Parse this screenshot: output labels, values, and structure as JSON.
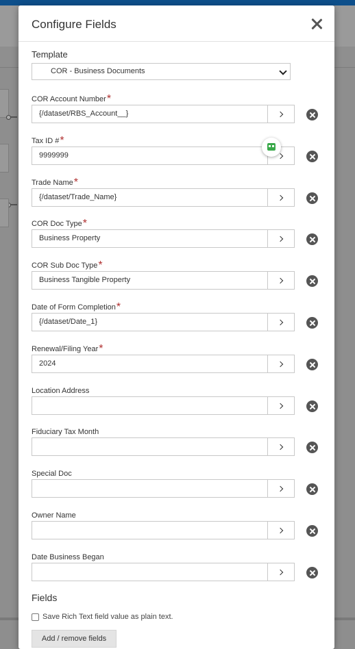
{
  "dialog": {
    "title": "Configure Fields",
    "template_label": "Template",
    "template_value": "COR - Business Documents"
  },
  "fields": [
    {
      "label": "COR Account Number",
      "value": "{/dataset/RBS_Account__}",
      "required_mark": "*"
    },
    {
      "label": "Tax ID #",
      "value": "9999999",
      "required_mark": "*"
    },
    {
      "label": "Trade Name",
      "value": "{/dataset/Trade_Name}",
      "required_mark": "*"
    },
    {
      "label": "COR Doc Type",
      "value": "Business Property",
      "required_mark": "*"
    },
    {
      "label": "COR Sub Doc Type",
      "value": "Business Tangible Property",
      "required_mark": "*"
    },
    {
      "label": "Date of Form Completion",
      "value": "{/dataset/Date_1}",
      "required_mark": "*"
    },
    {
      "label": "Renewal/Filing Year",
      "value": "2024",
      "required_mark": "*"
    },
    {
      "label": "Location Address",
      "value": ""
    },
    {
      "label": "Fiduciary Tax Month",
      "value": ""
    },
    {
      "label": "Special Doc",
      "value": ""
    },
    {
      "label": "Owner Name",
      "value": ""
    },
    {
      "label": "Date Business Began",
      "value": ""
    }
  ],
  "footer": {
    "fields_heading": "Fields",
    "plain_text_checkbox": "Save Rich Text field value as plain text.",
    "add_remove_button": "Add / remove fields"
  },
  "colors": {
    "topbar": "#0d4f8b",
    "required": "#b03030",
    "remove_icon": "#555555",
    "assistant_icon": "#3aa94a"
  }
}
